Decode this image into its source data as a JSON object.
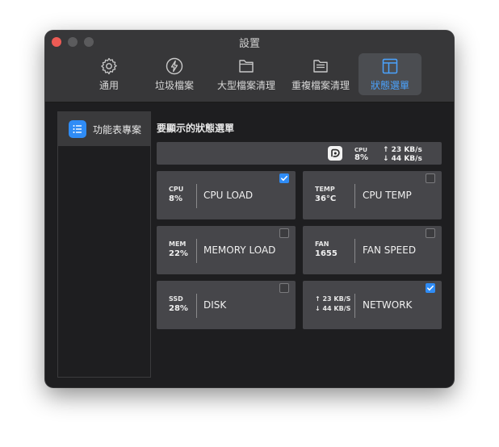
{
  "window": {
    "title": "設置"
  },
  "toolbar": {
    "tabs": [
      {
        "label": "通用",
        "icon": "gear-icon"
      },
      {
        "label": "垃圾檔案",
        "icon": "bolt-icon"
      },
      {
        "label": "大型檔案清理",
        "icon": "folder-icon"
      },
      {
        "label": "重複檔案清理",
        "icon": "duplicate-folder-icon"
      },
      {
        "label": "狀態選單",
        "icon": "layout-panel-icon",
        "active": true
      }
    ]
  },
  "sidebar": {
    "items": [
      {
        "label": "功能表專案",
        "icon": "list-icon",
        "selected": true
      }
    ]
  },
  "main": {
    "title": "要顯示的狀態選單",
    "preview": {
      "cpu_label": "CPU",
      "cpu_value": "8%",
      "net_up": "↑ 23 KB/s",
      "net_down": "↓ 44 KB/s"
    },
    "cards": [
      {
        "small": "CPU",
        "value": "8%",
        "name": "CPU LOAD",
        "checked": true
      },
      {
        "small": "TEMP",
        "value": "36°C",
        "name": "CPU TEMP",
        "checked": false
      },
      {
        "small": "MEM",
        "value": "22%",
        "name": "MEMORY LOAD",
        "checked": false
      },
      {
        "small": "FAN",
        "value": "1655",
        "name": "FAN SPEED",
        "checked": false
      },
      {
        "small": "SSD",
        "value": "28%",
        "name": "DISK",
        "checked": false
      },
      {
        "up": "↑ 23 KB/S",
        "down": "↓ 44 KB/S",
        "name": "NETWORK",
        "checked": true
      }
    ]
  },
  "colors": {
    "accent": "#2f8cf6",
    "active_tab_text": "#4ba3ff",
    "close_button": "#ed5b55"
  }
}
